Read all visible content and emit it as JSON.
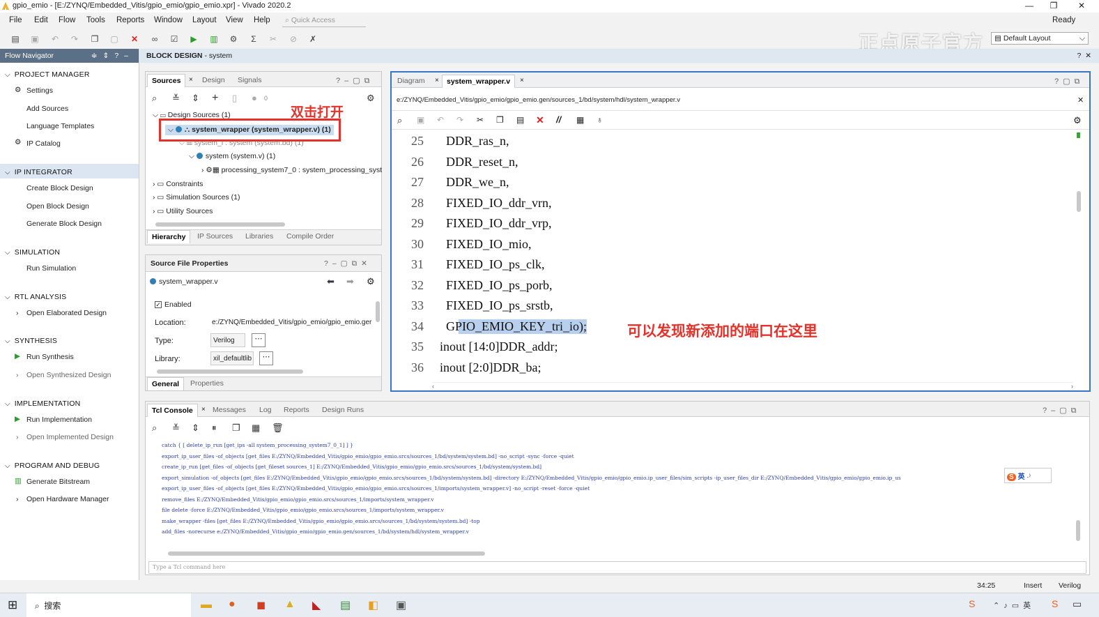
{
  "app": {
    "title": "gpio_emio - [E:/ZYNQ/Embedded_Vitis/gpio_emio/gpio_emio.xpr] - Vivado 2020.2",
    "status_ready": "Ready"
  },
  "menu": [
    "File",
    "Edit",
    "Flow",
    "Tools",
    "Reports",
    "Window",
    "Layout",
    "View",
    "Help"
  ],
  "quick_access": "Quick Access",
  "layout_select": "Default Layout",
  "watermark": "正点原子官方",
  "flow_navigator": {
    "title": "Flow Navigator",
    "sections": [
      {
        "label": "PROJECT MANAGER",
        "items": [
          "Settings",
          "Add Sources",
          "Language Templates",
          "IP Catalog"
        ]
      },
      {
        "label": "IP INTEGRATOR",
        "items": [
          "Create Block Design",
          "Open Block Design",
          "Generate Block Design"
        ]
      },
      {
        "label": "SIMULATION",
        "items": [
          "Run Simulation"
        ]
      },
      {
        "label": "RTL ANALYSIS",
        "items": [
          "Open Elaborated Design"
        ]
      },
      {
        "label": "SYNTHESIS",
        "items": [
          "Run Synthesis",
          "Open Synthesized Design"
        ]
      },
      {
        "label": "IMPLEMENTATION",
        "items": [
          "Run Implementation",
          "Open Implemented Design"
        ]
      },
      {
        "label": "PROGRAM AND DEBUG",
        "items": [
          "Generate Bitstream",
          "Open Hardware Manager"
        ]
      }
    ]
  },
  "block_design": {
    "title": "BLOCK DESIGN",
    "name": "- system"
  },
  "sources": {
    "tabs": [
      "Sources",
      "Design",
      "Signals"
    ],
    "count": "0",
    "tree": [
      "Design Sources (1)",
      "system_wrapper (system_wrapper.v) (1)",
      "system_i : system (system.bd) (1)",
      "system (system.v) (1)",
      "processing_system7_0 : system_processing_syst",
      "Constraints",
      "Simulation Sources (1)",
      "Utility Sources"
    ],
    "bottom_tabs": [
      "Hierarchy",
      "IP Sources",
      "Libraries",
      "Compile Order"
    ]
  },
  "annotations": {
    "double_click": "双击打开",
    "new_port": "可以发现新添加的端口在这里"
  },
  "sfp": {
    "title": "Source File Properties",
    "file": "system_wrapper.v",
    "enabled": "Enabled",
    "location_label": "Location:",
    "location": "e:/ZYNQ/Embedded_Vitis/gpio_emio/gpio_emio.ger",
    "type_label": "Type:",
    "type": "Verilog",
    "library_label": "Library:",
    "library": "xil_defaultlib",
    "bottom_tabs": [
      "General",
      "Properties"
    ]
  },
  "editor": {
    "tabs": [
      "Diagram",
      "system_wrapper.v"
    ],
    "path": "e:/ZYNQ/Embedded_Vitis/gpio_emio/gpio_emio.gen/sources_1/bd/system/hdl/system_wrapper.v",
    "lines": [
      {
        "n": "25",
        "t": "    DDR_ras_n,"
      },
      {
        "n": "26",
        "t": "    DDR_reset_n,"
      },
      {
        "n": "27",
        "t": "    DDR_we_n,"
      },
      {
        "n": "28",
        "t": "    FIXED_IO_ddr_vrn,"
      },
      {
        "n": "29",
        "t": "    FIXED_IO_ddr_vrp,"
      },
      {
        "n": "30",
        "t": "    FIXED_IO_mio,"
      },
      {
        "n": "31",
        "t": "    FIXED_IO_ps_clk,"
      },
      {
        "n": "32",
        "t": "    FIXED_IO_ps_porb,"
      },
      {
        "n": "33",
        "t": "    FIXED_IO_ps_srstb,"
      },
      {
        "n": "34",
        "t": "    GPIO_EMIO_KEY_tri_io);"
      },
      {
        "n": "35",
        "t": "  inout [14:0]DDR_addr;"
      },
      {
        "n": "36",
        "t": "  inout [2:0]DDR_ba;"
      }
    ]
  },
  "tcl": {
    "tabs": [
      "Tcl Console",
      "Messages",
      "Log",
      "Reports",
      "Design Runs"
    ],
    "placeholder": "Type a Tcl command here",
    "lines": [
      "catch { [ delete_ip_run [get_ips -all system_processing_system7_0_1] ] }",
      "export_ip_user_files -of_objects [get_files E:/ZYNQ/Embedded_Vitis/gpio_emio/gpio_emio.srcs/sources_1/bd/system/system.bd] -no_script -sync -force -quiet",
      "create_ip_run [get_files -of_objects [get_fileset sources_1] E:/ZYNQ/Embedded_Vitis/gpio_emio/gpio_emio.srcs/sources_1/bd/system/system.bd]",
      "export_simulation -of_objects [get_files E:/ZYNQ/Embedded_Vitis/gpio_emio/gpio_emio.srcs/sources_1/bd/system/system.bd] -directory E:/ZYNQ/Embedded_Vitis/gpio_emio/gpio_emio.ip_user_files/sim_scripts -ip_user_files_dir E:/ZYNQ/Embedded_Vitis/gpio_emio/gpio_emio.ip_us",
      "export_ip_user_files -of_objects  [get_files E:/ZYNQ/Embedded_Vitis/gpio_emio/gpio_emio.srcs/sources_1/imports/system_wrapper.v] -no_script -reset -force -quiet",
      "remove_files  E:/ZYNQ/Embedded_Vitis/gpio_emio/gpio_emio.srcs/sources_1/imports/system_wrapper.v",
      "file delete -force E:/ZYNQ/Embedded_Vitis/gpio_emio/gpio_emio.srcs/sources_1/imports/system_wrapper.v",
      "make_wrapper -files [get_files E:/ZYNQ/Embedded_Vitis/gpio_emio/gpio_emio.srcs/sources_1/bd/system/system.bd] -top",
      "add_files -norecurse e:/ZYNQ/Embedded_Vitis/gpio_emio/gpio_emio.gen/sources_1/bd/system/hdl/system_wrapper.v"
    ],
    "ime": "英"
  },
  "status": {
    "pos": "34:25",
    "mode": "Insert",
    "lang": "Verilog"
  },
  "taskbar": {
    "search": "搜索"
  }
}
